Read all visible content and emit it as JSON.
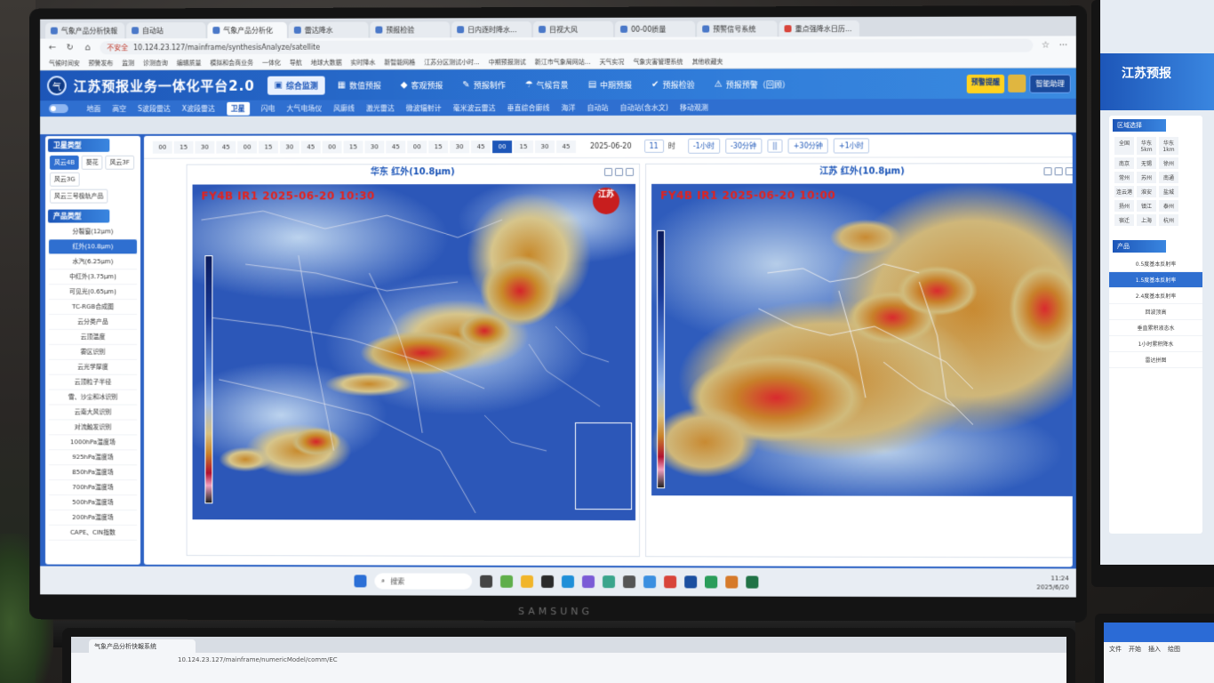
{
  "browser": {
    "tabs": [
      {
        "label": "气象产品分析快報"
      },
      {
        "label": "自动站"
      },
      {
        "label": "气象产品分析化"
      },
      {
        "label": "雷达降水"
      },
      {
        "label": "预报检验"
      },
      {
        "label": "日内逐时降水..."
      },
      {
        "label": "目视大风"
      },
      {
        "label": "00-00质量"
      },
      {
        "label": "预警信号系统"
      },
      {
        "label": "重点强降水日历..."
      }
    ],
    "security_label": "不安全",
    "url": "10.124.23.127/mainframe/synthesisAnalyze/satellite",
    "bookmarks": [
      "气候时间安",
      "预警发布",
      "监测",
      "诊测查询",
      "编辑质量",
      "模拟和会商业务",
      "一体化",
      "导航",
      "地球大数据",
      "实时降水",
      "新智能网格",
      "江苏分区测试小时...",
      "中期预报测试",
      "新江市气象局网站...",
      "天气实况",
      "气象灾害管理系统",
      "其他收藏夹"
    ]
  },
  "header": {
    "logo_text": "气",
    "title": "江苏预报业务一体化平台2.0",
    "main_nav": [
      {
        "label": "综合监测",
        "icon": "monitor-icon",
        "glyph": "▣"
      },
      {
        "label": "数值预报",
        "icon": "grid-icon",
        "glyph": "▦"
      },
      {
        "label": "客观预报",
        "icon": "diamond-icon",
        "glyph": "◆"
      },
      {
        "label": "预报制作",
        "icon": "edit-icon",
        "glyph": "✎"
      },
      {
        "label": "气候背景",
        "icon": "thermometer-icon",
        "glyph": "☂"
      },
      {
        "label": "中期预报",
        "icon": "calendar-icon",
        "glyph": "▤"
      },
      {
        "label": "预报检验",
        "icon": "check-icon",
        "glyph": "✔"
      },
      {
        "label": "预报预警（回顾）",
        "icon": "warning-icon",
        "glyph": "⚠"
      }
    ],
    "warn_label": "预警提醒",
    "user_label": "智能助理"
  },
  "sub_nav": [
    "地面",
    "高空",
    "S波段雷达",
    "X波段雷达",
    "卫星",
    "闪电",
    "大气电场仪",
    "风廓线",
    "激光雷达",
    "微波辐射计",
    "毫米波云雷达",
    "垂直综合廓线",
    "海洋",
    "自动站",
    "自动站(含水文)",
    "移动观测"
  ],
  "sub_nav_active": "卫星",
  "sidebar": {
    "sat_head": "卫星类型",
    "sat_types": [
      "风云4B",
      "葵花",
      "风云3F",
      "风云3G",
      "风云三号极轨产品"
    ],
    "sat_active": "风云4B",
    "prod_head": "产品类型",
    "products": [
      "分裂窗(12μm)",
      "红外(10.8μm)",
      "水汽(6.25μm)",
      "中红外(3.75μm)",
      "可见光(0.65μm)",
      "TC-RGB合成图",
      "云分类产品",
      "云顶温度",
      "雾区识别",
      "云光学厚度",
      "云顶粒子半径",
      "雪、沙尘和冰识别",
      "云南大风识别",
      "对流触发识别",
      "1000hPa温度场",
      "925hPa温度场",
      "850hPa温度场",
      "700hPa温度场",
      "500hPa温度场",
      "200hPa温度场",
      "CAPE、CIN指数"
    ],
    "prod_active": "红外(10.8μm)"
  },
  "time_bar": {
    "cells": [
      "00",
      "15",
      "30",
      "45",
      "00",
      "15",
      "30",
      "45",
      "00",
      "15",
      "30",
      "45",
      "00",
      "15",
      "30",
      "45",
      "00",
      "15",
      "30",
      "45"
    ],
    "active_index": 16,
    "date": "2025-06-20",
    "hour": "11",
    "hour_unit": "时",
    "controls": [
      "-1小时",
      "-30分钟",
      "||",
      "+30分钟",
      "+1小时"
    ]
  },
  "panels": {
    "left": {
      "title": "华东 红外(10.8μm)",
      "overlay": "FY4B IR1 2025-06-20 10:30",
      "stamp": "江苏"
    },
    "right": {
      "title": "江苏 红外(10.8μm)",
      "overlay": "FY4B IR1 2025-06-20 10:00"
    }
  },
  "taskbar": {
    "search": "搜索",
    "time": "11:24",
    "date": "2025/6/20"
  },
  "right_monitor": {
    "title": "江苏预报",
    "head1": "区域选择",
    "cells": [
      "全国",
      "华东5km",
      "华东1km",
      "南京",
      "无锡",
      "徐州",
      "常州",
      "苏州",
      "南通",
      "连云港",
      "淮安",
      "盐城",
      "扬州",
      "镇江",
      "泰州",
      "宿迁",
      "上海",
      "杭州"
    ],
    "head2": "产品",
    "items": [
      "0.5度基本反射率",
      "1.5度基本反射率",
      "2.4度基本反射率",
      "回波顶高",
      "垂直累积液态水",
      "1小时累积降水",
      "雷达拼图"
    ],
    "items_active": 1
  },
  "bottom_monitor": {
    "tab": "气象产品分析快報系统",
    "url": "10.124.23.127/mainframe/numericModel/comm/EC"
  },
  "bottom_right": {
    "tabs": [
      "文件",
      "开始",
      "插入",
      "绘图"
    ]
  },
  "monitor_brand": "SAMSUNG"
}
